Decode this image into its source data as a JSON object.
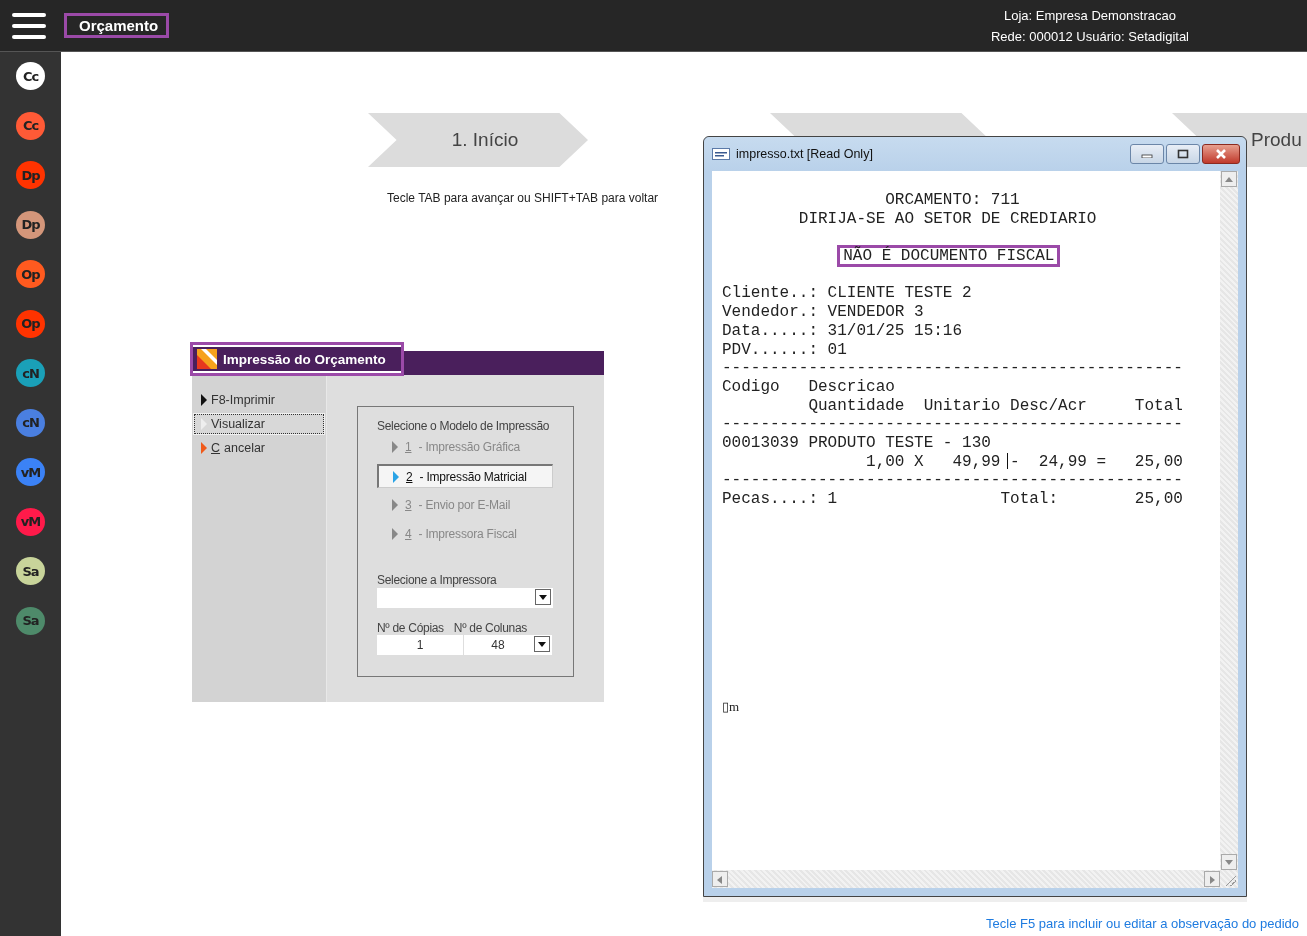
{
  "top_bar": {
    "title": "Orçamento",
    "highlighted": true,
    "store": "Loja: Empresa Demonstracao",
    "network": "Rede: 000012 Usuário: Setadigital"
  },
  "sidebar": {
    "items": [
      {
        "label": "Cc",
        "color": "#ffffff"
      },
      {
        "label": "Cc",
        "color": "#ff5a36"
      },
      {
        "label": "Dp",
        "color": "#ff3300"
      },
      {
        "label": "Dp",
        "color": "#d4967a"
      },
      {
        "label": "Op",
        "color": "#ff5a1f"
      },
      {
        "label": "Op",
        "color": "#ff3300"
      },
      {
        "label": "cN",
        "color": "#1aa0b8"
      },
      {
        "label": "cN",
        "color": "#4a7fe0"
      },
      {
        "label": "vM",
        "color": "#3b82f6"
      },
      {
        "label": "vM",
        "color": "#ff1a4a"
      },
      {
        "label": "Sa",
        "color": "#c8d49a"
      },
      {
        "label": "Sa",
        "color": "#4e8a6a"
      }
    ]
  },
  "steps": [
    {
      "kind": "labeled",
      "label": "1. Início"
    },
    {
      "kind": "blank"
    },
    {
      "kind": "labeled",
      "label": "Produ"
    }
  ],
  "hint": "Tecle TAB para avançar ou SHIFT+TAB para voltar",
  "print_dialog": {
    "title": "Impressão do Orçamento",
    "highlighted": true,
    "actions": [
      {
        "kind": "normal",
        "label": "F8-Imprimir",
        "selected": false
      },
      {
        "kind": "normal",
        "label": "Visualizar",
        "selected": true
      },
      {
        "kind": "cancel",
        "key": "C",
        "label": "ancelar",
        "selected": false
      }
    ],
    "model_group": {
      "title": "Selecione o Modelo de Impressão",
      "options": [
        {
          "key": "1",
          "label": " - Impressão Gráfica",
          "selected": false
        },
        {
          "key": "2",
          "label": " - Impressão Matricial",
          "selected": true
        },
        {
          "key": "3",
          "label": " - Envio por E-Mail",
          "selected": false
        },
        {
          "key": "4",
          "label": " - Impressora Fiscal",
          "selected": false
        }
      ],
      "printer_label": "Selecione a Impressora",
      "copies": {
        "label": "Nº de Cópias",
        "value": "1"
      },
      "columns": {
        "label": "Nº de Colunas",
        "value": "48"
      }
    }
  },
  "viewer": {
    "title": "impresso.txt [Read Only]",
    "lines": [
      {
        "kind": "text",
        "text": "                 ORCAMENTO: 711"
      },
      {
        "kind": "text",
        "text": "        DIRIJA-SE AO SETOR DE CREDIARIO"
      },
      {
        "kind": "blank"
      },
      {
        "kind": "boxed",
        "text": "NÃO É DOCUMENTO FISCAL",
        "highlighted": true
      },
      {
        "kind": "blank"
      },
      {
        "kind": "text",
        "text": "Cliente..: CLIENTE TESTE 2"
      },
      {
        "kind": "text",
        "text": "Vendedor.: VENDEDOR 3"
      },
      {
        "kind": "text",
        "text": "Data.....: 31/01/25 15:16"
      },
      {
        "kind": "text",
        "text": "PDV......: 01"
      },
      {
        "kind": "text",
        "text": "------------------------------------------------"
      },
      {
        "kind": "text",
        "text": "Codigo   Descricao"
      },
      {
        "kind": "text",
        "text": "         Quantidade  Unitario Desc/Acr     Total"
      },
      {
        "kind": "text",
        "text": "------------------------------------------------"
      },
      {
        "kind": "text",
        "text": "00013039 PRODUTO TESTE - 130"
      },
      {
        "kind": "cursor",
        "before": "               1,00 X   49,99 ",
        "after": "-  24,99 =   25,00"
      },
      {
        "kind": "text",
        "text": "------------------------------------------------"
      },
      {
        "kind": "text",
        "text": "Pecas....: 1                 Total:        25,00"
      },
      {
        "kind": "glyph",
        "text": "▯m"
      }
    ]
  },
  "footer_link": "Tecle F5 para incluir ou editar a observação do pedido"
}
